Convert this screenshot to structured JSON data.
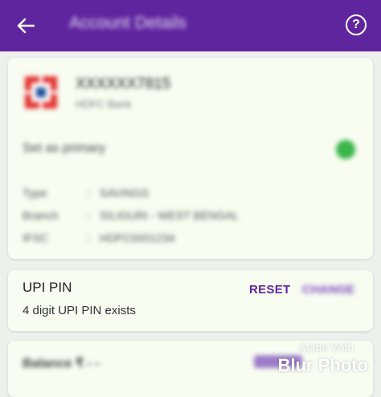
{
  "header": {
    "title": "Account Details",
    "help_glyph": "?",
    "background": "#5f259f"
  },
  "account": {
    "number": "XXXXXX7815",
    "bank_name": "HDFC Bank",
    "primary_label": "Set as primary",
    "primary_on": true,
    "primary_color": "#3bb54a",
    "details": [
      {
        "label": "Type",
        "sep": ":",
        "value": "SAVINGS"
      },
      {
        "label": "Branch",
        "sep": ":",
        "value": "SILIGURI - WEST BENGAL"
      },
      {
        "label": "IFSC",
        "sep": ":",
        "value": "HDFC0001234"
      }
    ]
  },
  "upi": {
    "title": "UPI PIN",
    "subtitle": "4 digit UPI PIN exists",
    "reset_label": "RESET",
    "change_label": "CHANGE",
    "accent": "#5f259f"
  },
  "balance": {
    "label": "Balance ₹ - -"
  },
  "watermark": {
    "line1": "Made With",
    "line2": "Blur Photo"
  },
  "icons": {
    "back": "back-arrow-icon",
    "help": "help-icon",
    "bank": "bank-logo-icon"
  }
}
